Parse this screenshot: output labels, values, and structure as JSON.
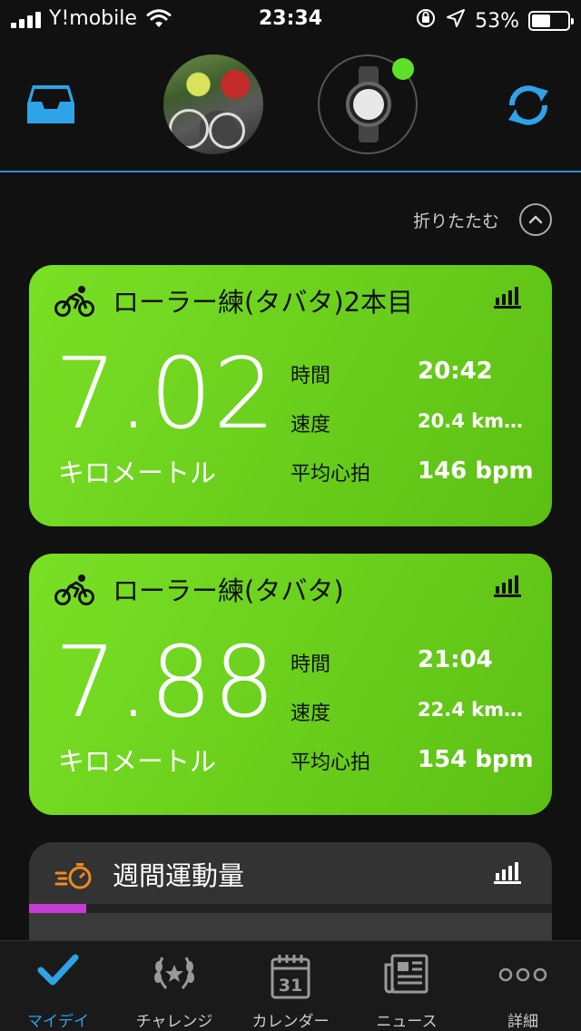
{
  "status_bar": {
    "carrier": "Y!mobile",
    "time": "23:34",
    "battery": "53%",
    "battery_level": 0.53
  },
  "header": {
    "inbox_icon": "inbox-tray-icon",
    "sync_icon": "sync-icon",
    "device_connected_color": "#5ee02a"
  },
  "collapse": {
    "label": "折りたたむ"
  },
  "activities": [
    {
      "title": "ローラー練(タバタ)2本目",
      "distance": "7.02",
      "unit": "キロメートル",
      "stats": [
        {
          "label": "時間",
          "value": "20:42"
        },
        {
          "label": "速度",
          "value": "20.4 km…"
        },
        {
          "label": "平均心拍",
          "value": "146 bpm"
        }
      ]
    },
    {
      "title": "ローラー練(タバタ)",
      "distance": "7.88",
      "unit": "キロメートル",
      "stats": [
        {
          "label": "時間",
          "value": "21:04"
        },
        {
          "label": "速度",
          "value": "22.4 km…"
        },
        {
          "label": "平均心拍",
          "value": "154 bpm"
        }
      ]
    }
  ],
  "weekly": {
    "title": "週間運動量",
    "progress": 0.11,
    "progress_color": "#c43cd0"
  },
  "tabs": [
    {
      "label": "マイデイ",
      "icon": "checkmark-icon",
      "active": true
    },
    {
      "label": "チャレンジ",
      "icon": "laurel-icon",
      "active": false
    },
    {
      "label": "カレンダー",
      "icon": "calendar-icon",
      "active": false
    },
    {
      "label": "ニュース",
      "icon": "newspaper-icon",
      "active": false
    },
    {
      "label": "詳細",
      "icon": "more-dots-icon",
      "active": false
    }
  ],
  "colors": {
    "accent": "#2ea3e8",
    "card_green": "#6fd21e"
  }
}
